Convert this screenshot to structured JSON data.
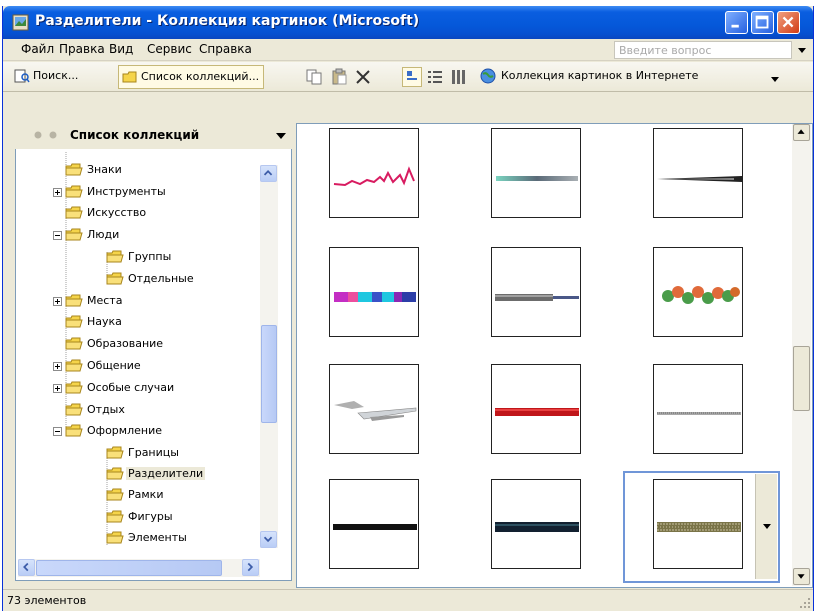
{
  "window": {
    "title": "Разделители - Коллекция картинок (Microsoft)"
  },
  "menu": {
    "items": [
      "Файл",
      "Правка",
      "Вид",
      "Сервис",
      "Справка"
    ],
    "help_placeholder": "Введите вопрос"
  },
  "toolbar": {
    "search_label": "Поиск...",
    "collections_label": "Список коллекций...",
    "online_label": "Коллекция картинок в Интернете"
  },
  "left_pane": {
    "title": "Список коллекций",
    "items": [
      {
        "label": "Знаки"
      },
      {
        "label": "Инструменты"
      },
      {
        "label": "Искусство"
      },
      {
        "label": "Люди"
      },
      {
        "label": "Группы"
      },
      {
        "label": "Отдельные"
      },
      {
        "label": "Места"
      },
      {
        "label": "Наука"
      },
      {
        "label": "Образование"
      },
      {
        "label": "Общение"
      },
      {
        "label": "Особые случаи"
      },
      {
        "label": "Отдых"
      },
      {
        "label": "Оформление"
      },
      {
        "label": "Границы"
      },
      {
        "label": "Разделители",
        "selected": true
      },
      {
        "label": "Рамки"
      },
      {
        "label": "Фигуры"
      },
      {
        "label": "Элементы"
      }
    ]
  },
  "status": {
    "text": "73 элементов"
  },
  "colors": {
    "title_blue": "#0558d9",
    "selection_blue": "#7096d8",
    "folder_yellow": "#f5d44a"
  }
}
